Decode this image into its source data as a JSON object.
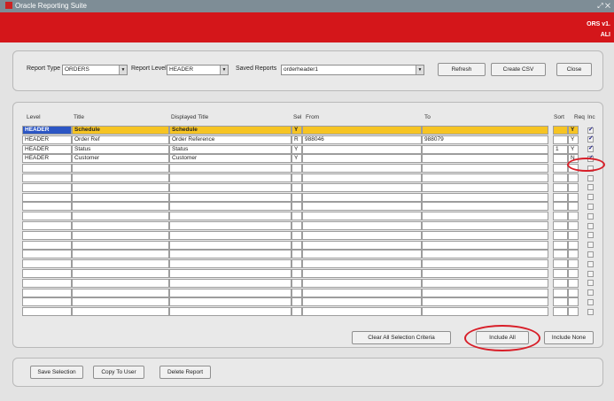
{
  "window": {
    "title": "Oracle Reporting Suite",
    "version": "ORS v1.",
    "user": "ALI"
  },
  "filters": {
    "report_type_label": "Report Type",
    "report_type_value": "ORDERS",
    "report_level_label": "Report Level",
    "report_level_value": "HEADER",
    "saved_reports_label": "Saved Reports",
    "saved_reports_value": "orderheader1"
  },
  "toolbar": {
    "refresh": "Refresh",
    "create_csv": "Create CSV",
    "close": "Close"
  },
  "grid": {
    "headers": {
      "level": "Level",
      "title": "Title",
      "displayed_title": "Displayed Title",
      "sel": "Sel",
      "from": "From",
      "to": "To",
      "sort": "Sort",
      "req": "Req",
      "inc": "Inc"
    },
    "rows": [
      {
        "level": "HEADER",
        "title": "Schedule",
        "displayed": "Schedule",
        "sel": "Y",
        "from": "",
        "to": "",
        "sort": "",
        "req": "Y",
        "inc": true
      },
      {
        "level": "HEADER",
        "title": "Order Ref",
        "displayed": "Order Reference",
        "sel": "R",
        "from": "988046",
        "to": "988079",
        "sort": "",
        "req": "Y",
        "inc": true
      },
      {
        "level": "HEADER",
        "title": "Status",
        "displayed": "Status",
        "sel": "Y",
        "from": "",
        "to": "",
        "sort": "1",
        "req": "Y",
        "inc": true
      },
      {
        "level": "HEADER",
        "title": "Customer",
        "displayed": "Customer",
        "sel": "Y",
        "from": "",
        "to": "",
        "sort": "",
        "req": "N",
        "inc": true
      }
    ]
  },
  "grid_buttons": {
    "clear_all": "Clear All Selection Criteria",
    "include_all": "Include All",
    "include_none": "Include None"
  },
  "bottom_buttons": {
    "save_selection": "Save Selection",
    "copy_to_user": "Copy To User",
    "delete_report": "Delete Report"
  }
}
